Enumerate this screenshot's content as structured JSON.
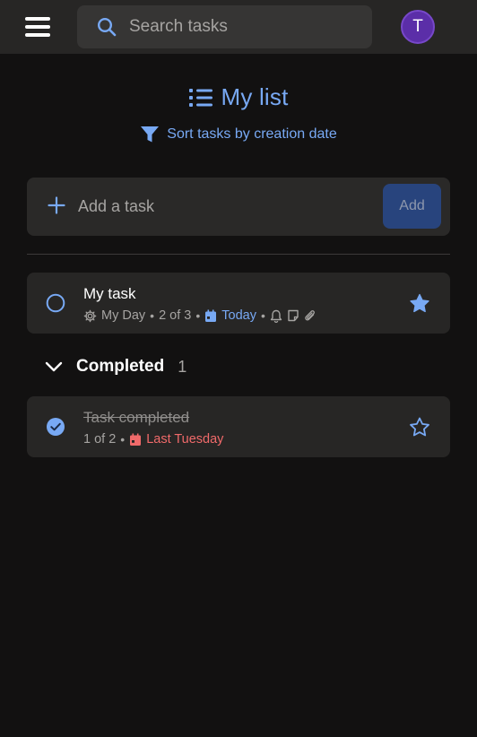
{
  "topbar": {
    "search_placeholder": "Search tasks",
    "avatar_initial": "T"
  },
  "list": {
    "title": "My list",
    "sort_label": "Sort tasks by creation date"
  },
  "add_task": {
    "placeholder": "Add a task",
    "button_label": "Add"
  },
  "tasks": [
    {
      "title": "My task",
      "list_name": "My Day",
      "steps": "2 of 3",
      "due": "Today",
      "starred": true,
      "completed": false
    }
  ],
  "completed": {
    "label": "Completed",
    "count": "1",
    "tasks": [
      {
        "title": "Task completed",
        "steps": "1 of 2",
        "due": "Last Tuesday",
        "starred": false,
        "completed": true
      }
    ]
  },
  "colors": {
    "background": "#121111",
    "accent": "#78a9f4",
    "overdue": "#f06a6a",
    "avatar": "#5b2ea8"
  },
  "icons": [
    "menu-icon",
    "search-icon",
    "list-icon",
    "filter-icon",
    "plus-icon",
    "circle-icon",
    "gear-icon",
    "calendar-icon",
    "bell-icon",
    "note-icon",
    "paperclip-icon",
    "star-icon",
    "chevron-down-icon",
    "check-circle-icon"
  ]
}
